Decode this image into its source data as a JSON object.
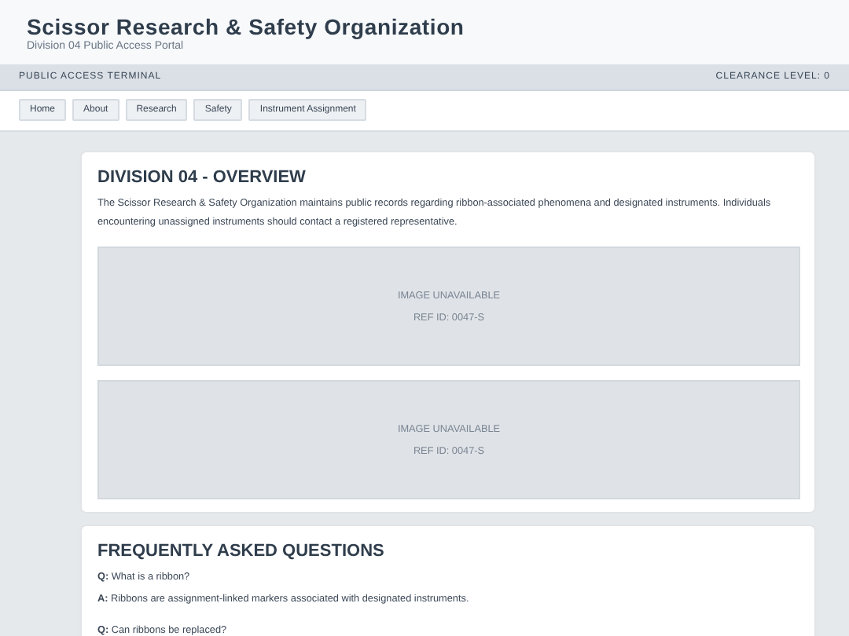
{
  "header": {
    "title": "Scissor Research & Safety Organization",
    "subtitle": "Division 04 Public Access Portal"
  },
  "status_bar": {
    "left": "PUBLIC ACCESS TERMINAL",
    "right": "CLEARANCE LEVEL: 0"
  },
  "nav": [
    "Home",
    "About",
    "Research",
    "Safety",
    "Instrument Assignment"
  ],
  "overview": {
    "heading": "DIVISION 04 - OVERVIEW",
    "text": "The Scissor Research & Safety Organization maintains public records regarding ribbon-associated phenomena and designated instruments. Individuals encountering unassigned instruments should contact a registered representative.",
    "images": [
      {
        "status": "IMAGE UNAVAILABLE",
        "ref": "REF ID: 0047-S"
      },
      {
        "status": "IMAGE UNAVAILABLE",
        "ref": "REF ID: 0047-S"
      }
    ]
  },
  "faq": {
    "heading": "FREQUENTLY ASKED QUESTIONS",
    "items": [
      {
        "question": "**Q:** What is a ribbon?",
        "answer": "**A:** Ribbons are assignment-linked markers associated with designated instruments."
      },
      {
        "question": "**Q:** Can ribbons be replaced?"
      }
    ]
  }
}
